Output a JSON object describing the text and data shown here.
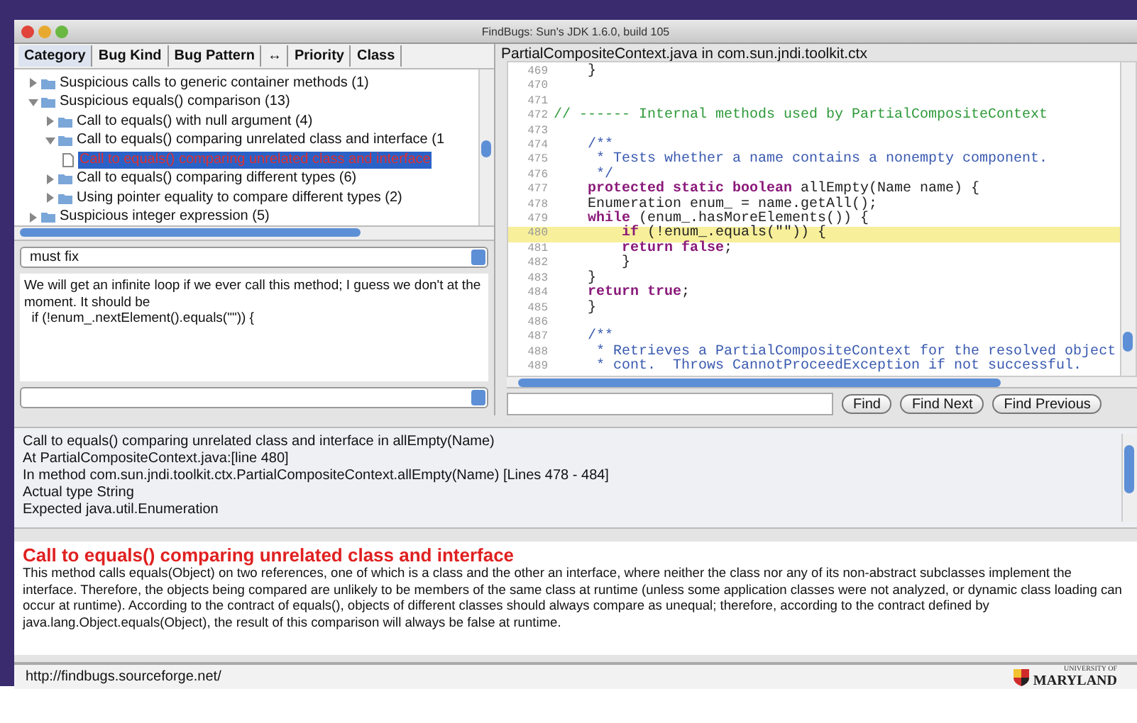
{
  "window": {
    "title": "FindBugs: Sun's JDK 1.6.0, build 105"
  },
  "tree_header": {
    "columns": [
      {
        "label": "Category",
        "selected": true
      },
      {
        "label": "Bug Kind",
        "selected": false
      },
      {
        "label": "Bug Pattern",
        "selected": false
      },
      {
        "label": "↔",
        "selected": false
      },
      {
        "label": "Priority",
        "selected": false
      },
      {
        "label": "Class",
        "selected": false
      }
    ]
  },
  "tree": [
    {
      "label": "Suspicious calls to generic container methods (1)",
      "expanded": false,
      "selected": false
    },
    {
      "label": "Suspicious equals() comparison (13)",
      "expanded": true,
      "selected": false,
      "children": [
        {
          "label": "Call to equals() with null argument (4)",
          "expanded": false,
          "selected": false
        },
        {
          "label": "Call to equals() comparing unrelated class and interface (1",
          "expanded": true,
          "selected": false,
          "children": [
            {
              "label": "Call to equals() comparing unrelated class and interface",
              "kind": "bug",
              "selected": true
            }
          ]
        },
        {
          "label": "Call to equals() comparing different types (6)",
          "expanded": false,
          "selected": false
        },
        {
          "label": "Using pointer equality to compare different types (2)",
          "expanded": false,
          "selected": false
        }
      ]
    },
    {
      "label": "Suspicious integer expression (5)",
      "expanded": false,
      "selected": false
    }
  ],
  "designation": {
    "value": "must fix"
  },
  "annotation": {
    "lines": [
      "We will get an infinite loop if we ever call this method; I guess we don't at the moment. It should be",
      "  if (!enum_.nextElement().equals(\"\")) {"
    ]
  },
  "source": {
    "title": "PartialCompositeContext.java in com.sun.jndi.toolkit.ctx",
    "lines": [
      {
        "number": "469",
        "highlighted": false,
        "tokens": [
          {
            "kind": "code",
            "text": "    }"
          }
        ]
      },
      {
        "number": "470",
        "highlighted": false
      },
      {
        "number": "471",
        "highlighted": false
      },
      {
        "number": "472",
        "highlighted": false,
        "tokens": [
          {
            "kind": "comment",
            "text": "// ------ Internal methods used by PartialCompositeContext"
          }
        ]
      },
      {
        "number": "473",
        "highlighted": false
      },
      {
        "number": "474",
        "highlighted": false,
        "tokens": [
          {
            "kind": "doc",
            "text": "    /**"
          }
        ]
      },
      {
        "number": "475",
        "highlighted": false,
        "tokens": [
          {
            "kind": "doc",
            "text": "     * Tests whether a name contains a nonempty component."
          }
        ]
      },
      {
        "number": "476",
        "highlighted": false,
        "tokens": [
          {
            "kind": "doc",
            "text": "     */"
          }
        ]
      },
      {
        "number": "477",
        "highlighted": false,
        "tokens": [
          {
            "kind": "keyword",
            "text": "    protected static boolean"
          },
          {
            "kind": "code",
            "text": " allEmpty(Name name) {"
          }
        ]
      },
      {
        "number": "478",
        "highlighted": false,
        "tokens": [
          {
            "kind": "code",
            "text": "    Enumeration enum_ = name.getAll();"
          }
        ]
      },
      {
        "number": "479",
        "highlighted": false,
        "tokens": [
          {
            "kind": "keyword",
            "text": "    while"
          },
          {
            "kind": "code",
            "text": " (enum_.hasMoreElements()) {"
          }
        ]
      },
      {
        "number": "480",
        "highlighted": true,
        "tokens": [
          {
            "kind": "keyword",
            "text": "        if"
          },
          {
            "kind": "code",
            "text": " (!enum_.equals(\"\")) {"
          }
        ]
      },
      {
        "number": "481",
        "highlighted": false,
        "tokens": [
          {
            "kind": "keyword",
            "text": "        return false"
          },
          {
            "kind": "code",
            "text": ";"
          }
        ]
      },
      {
        "number": "482",
        "highlighted": false,
        "tokens": [
          {
            "kind": "code",
            "text": "        }"
          }
        ]
      },
      {
        "number": "483",
        "highlighted": false,
        "tokens": [
          {
            "kind": "code",
            "text": "    }"
          }
        ]
      },
      {
        "number": "484",
        "highlighted": false,
        "tokens": [
          {
            "kind": "keyword",
            "text": "    return true"
          },
          {
            "kind": "code",
            "text": ";"
          }
        ]
      },
      {
        "number": "485",
        "highlighted": false,
        "tokens": [
          {
            "kind": "code",
            "text": "    }"
          }
        ]
      },
      {
        "number": "486",
        "highlighted": false
      },
      {
        "number": "487",
        "highlighted": false,
        "tokens": [
          {
            "kind": "doc",
            "text": "    /**"
          }
        ]
      },
      {
        "number": "488",
        "highlighted": false,
        "tokens": [
          {
            "kind": "doc",
            "text": "     * Retrieves a PartialCompositeContext for the resolved object"
          }
        ]
      },
      {
        "number": "489",
        "highlighted": false,
        "tokens": [
          {
            "kind": "doc",
            "text": "     * cont.  Throws CannotProceedException if not successful."
          }
        ]
      }
    ]
  },
  "find": {
    "buttons": [
      "Find",
      "Find Next",
      "Find Previous"
    ]
  },
  "details": [
    "Call to equals() comparing unrelated class and interface in allEmpty(Name)",
    "At PartialCompositeContext.java:[line 480]",
    "In method com.sun.jndi.toolkit.ctx.PartialCompositeContext.allEmpty(Name) [Lines 478 - 484]",
    "Actual type String",
    "Expected java.util.Enumeration"
  ],
  "description": {
    "title": "Call to equals() comparing unrelated class and interface",
    "body": "This method calls equals(Object) on two references, one of which is a class and the other an interface, where neither the class nor any of its non-abstract subclasses implement the interface. Therefore, the objects being compared are unlikely to be members of the same class at runtime (unless some application classes were not analyzed, or dynamic class loading can occur at runtime). According to the contract of equals(), objects of different classes should always compare as unequal; therefore, according to the contract defined by java.lang.Object.equals(Object), the result of this comparison will always be false at runtime."
  },
  "status_bar": {
    "url": "http://findbugs.sourceforge.net/",
    "logo_top": "UNIVERSITY OF",
    "logo_name": "MARYLAND"
  }
}
